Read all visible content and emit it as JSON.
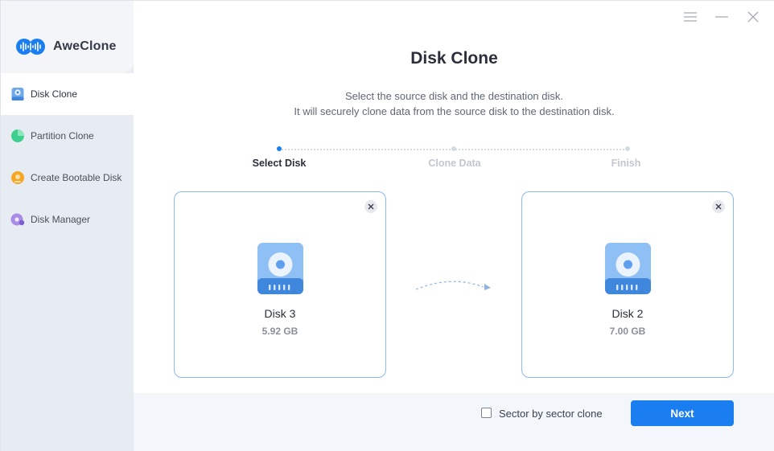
{
  "app": {
    "name": "AweClone",
    "brand_color": "#1a7ef0"
  },
  "sidebar": {
    "items": [
      {
        "label": "Disk Clone",
        "icon": "disk-clone-icon",
        "active": true
      },
      {
        "label": "Partition Clone",
        "icon": "partition-clone-icon",
        "active": false
      },
      {
        "label": "Create Bootable Disk",
        "icon": "bootable-disk-icon",
        "active": false
      },
      {
        "label": "Disk Manager",
        "icon": "disk-manager-icon",
        "active": false
      }
    ]
  },
  "window_controls": [
    "menu-icon",
    "minimize-icon",
    "close-icon"
  ],
  "main": {
    "title": "Disk Clone",
    "description_line1": "Select the source disk and the destination disk.",
    "description_line2": "It will securely clone data from the source disk to the destination disk.",
    "steps": [
      {
        "label": "Select Disk",
        "active": true
      },
      {
        "label": "Clone Data",
        "active": false
      },
      {
        "label": "Finish",
        "active": false
      }
    ],
    "source_disk": {
      "name": "Disk 3",
      "size": "5.92 GB"
    },
    "destination_disk": {
      "name": "Disk 2",
      "size": "7.00 GB"
    }
  },
  "footer": {
    "sector_label": "Sector by sector clone",
    "sector_checked": false,
    "next_label": "Next"
  }
}
